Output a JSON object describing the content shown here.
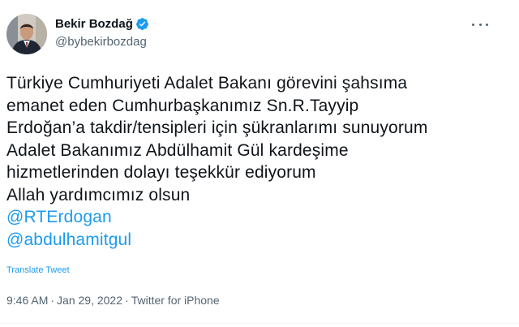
{
  "author": {
    "display_name": "Bekir Bozdağ",
    "handle": "@bybekirbozdag",
    "verified": true
  },
  "icons": {
    "verified": "verified-badge-icon",
    "more": "more-options-icon"
  },
  "colors": {
    "accent": "#1d9bf0",
    "text": "#0f1419",
    "secondary": "#536471"
  },
  "tweet": {
    "lines": [
      "Türkiye Cumhuriyeti Adalet Bakanı görevini şahsıma",
      "emanet eden Cumhurbaşkanımız Sn.R.Tayyip",
      "Erdoğan’a takdir/tensipleri için şükranlarımı sunuyorum",
      "Adalet Bakanımız Abdülhamit Gül kardeşime",
      "hizmetlerinden dolayı teşekkür ediyorum",
      "Allah yardımcımız olsun"
    ],
    "mentions": [
      "@RTErdogan",
      "@abdulhamitgul"
    ],
    "translate_label": "Translate Tweet"
  },
  "meta": {
    "time": "9:46 AM",
    "date": "Jan 29, 2022",
    "source": "Twitter for iPhone",
    "separator": "·"
  }
}
